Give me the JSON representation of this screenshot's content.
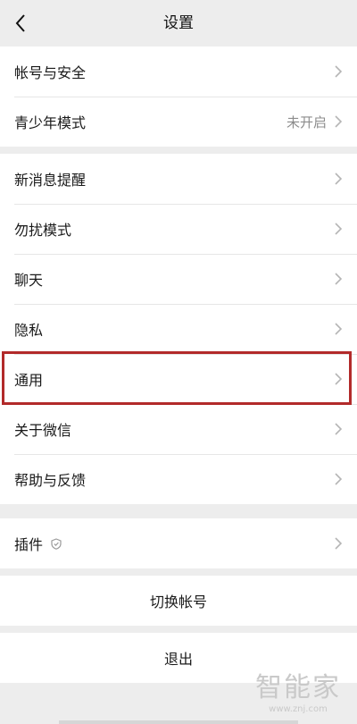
{
  "header": {
    "title": "设置",
    "back_icon": "chevron-left-icon"
  },
  "group1": {
    "items": [
      {
        "label": "帐号与安全",
        "value": ""
      },
      {
        "label": "青少年模式",
        "value": "未开启"
      }
    ]
  },
  "group2": {
    "items": [
      {
        "label": "新消息提醒"
      },
      {
        "label": "勿扰模式"
      },
      {
        "label": "聊天"
      },
      {
        "label": "隐私"
      },
      {
        "label": "通用"
      },
      {
        "label": "关于微信"
      },
      {
        "label": "帮助与反馈"
      }
    ]
  },
  "group3": {
    "items": [
      {
        "label": "插件",
        "icon": "shield-icon"
      }
    ]
  },
  "actions": {
    "switch_account": "切换帐号",
    "logout": "退出"
  },
  "watermark": {
    "brand": "智能家",
    "url": "www.znj.com"
  },
  "colors": {
    "background": "#ededed",
    "highlight_border": "#b22a2a"
  }
}
